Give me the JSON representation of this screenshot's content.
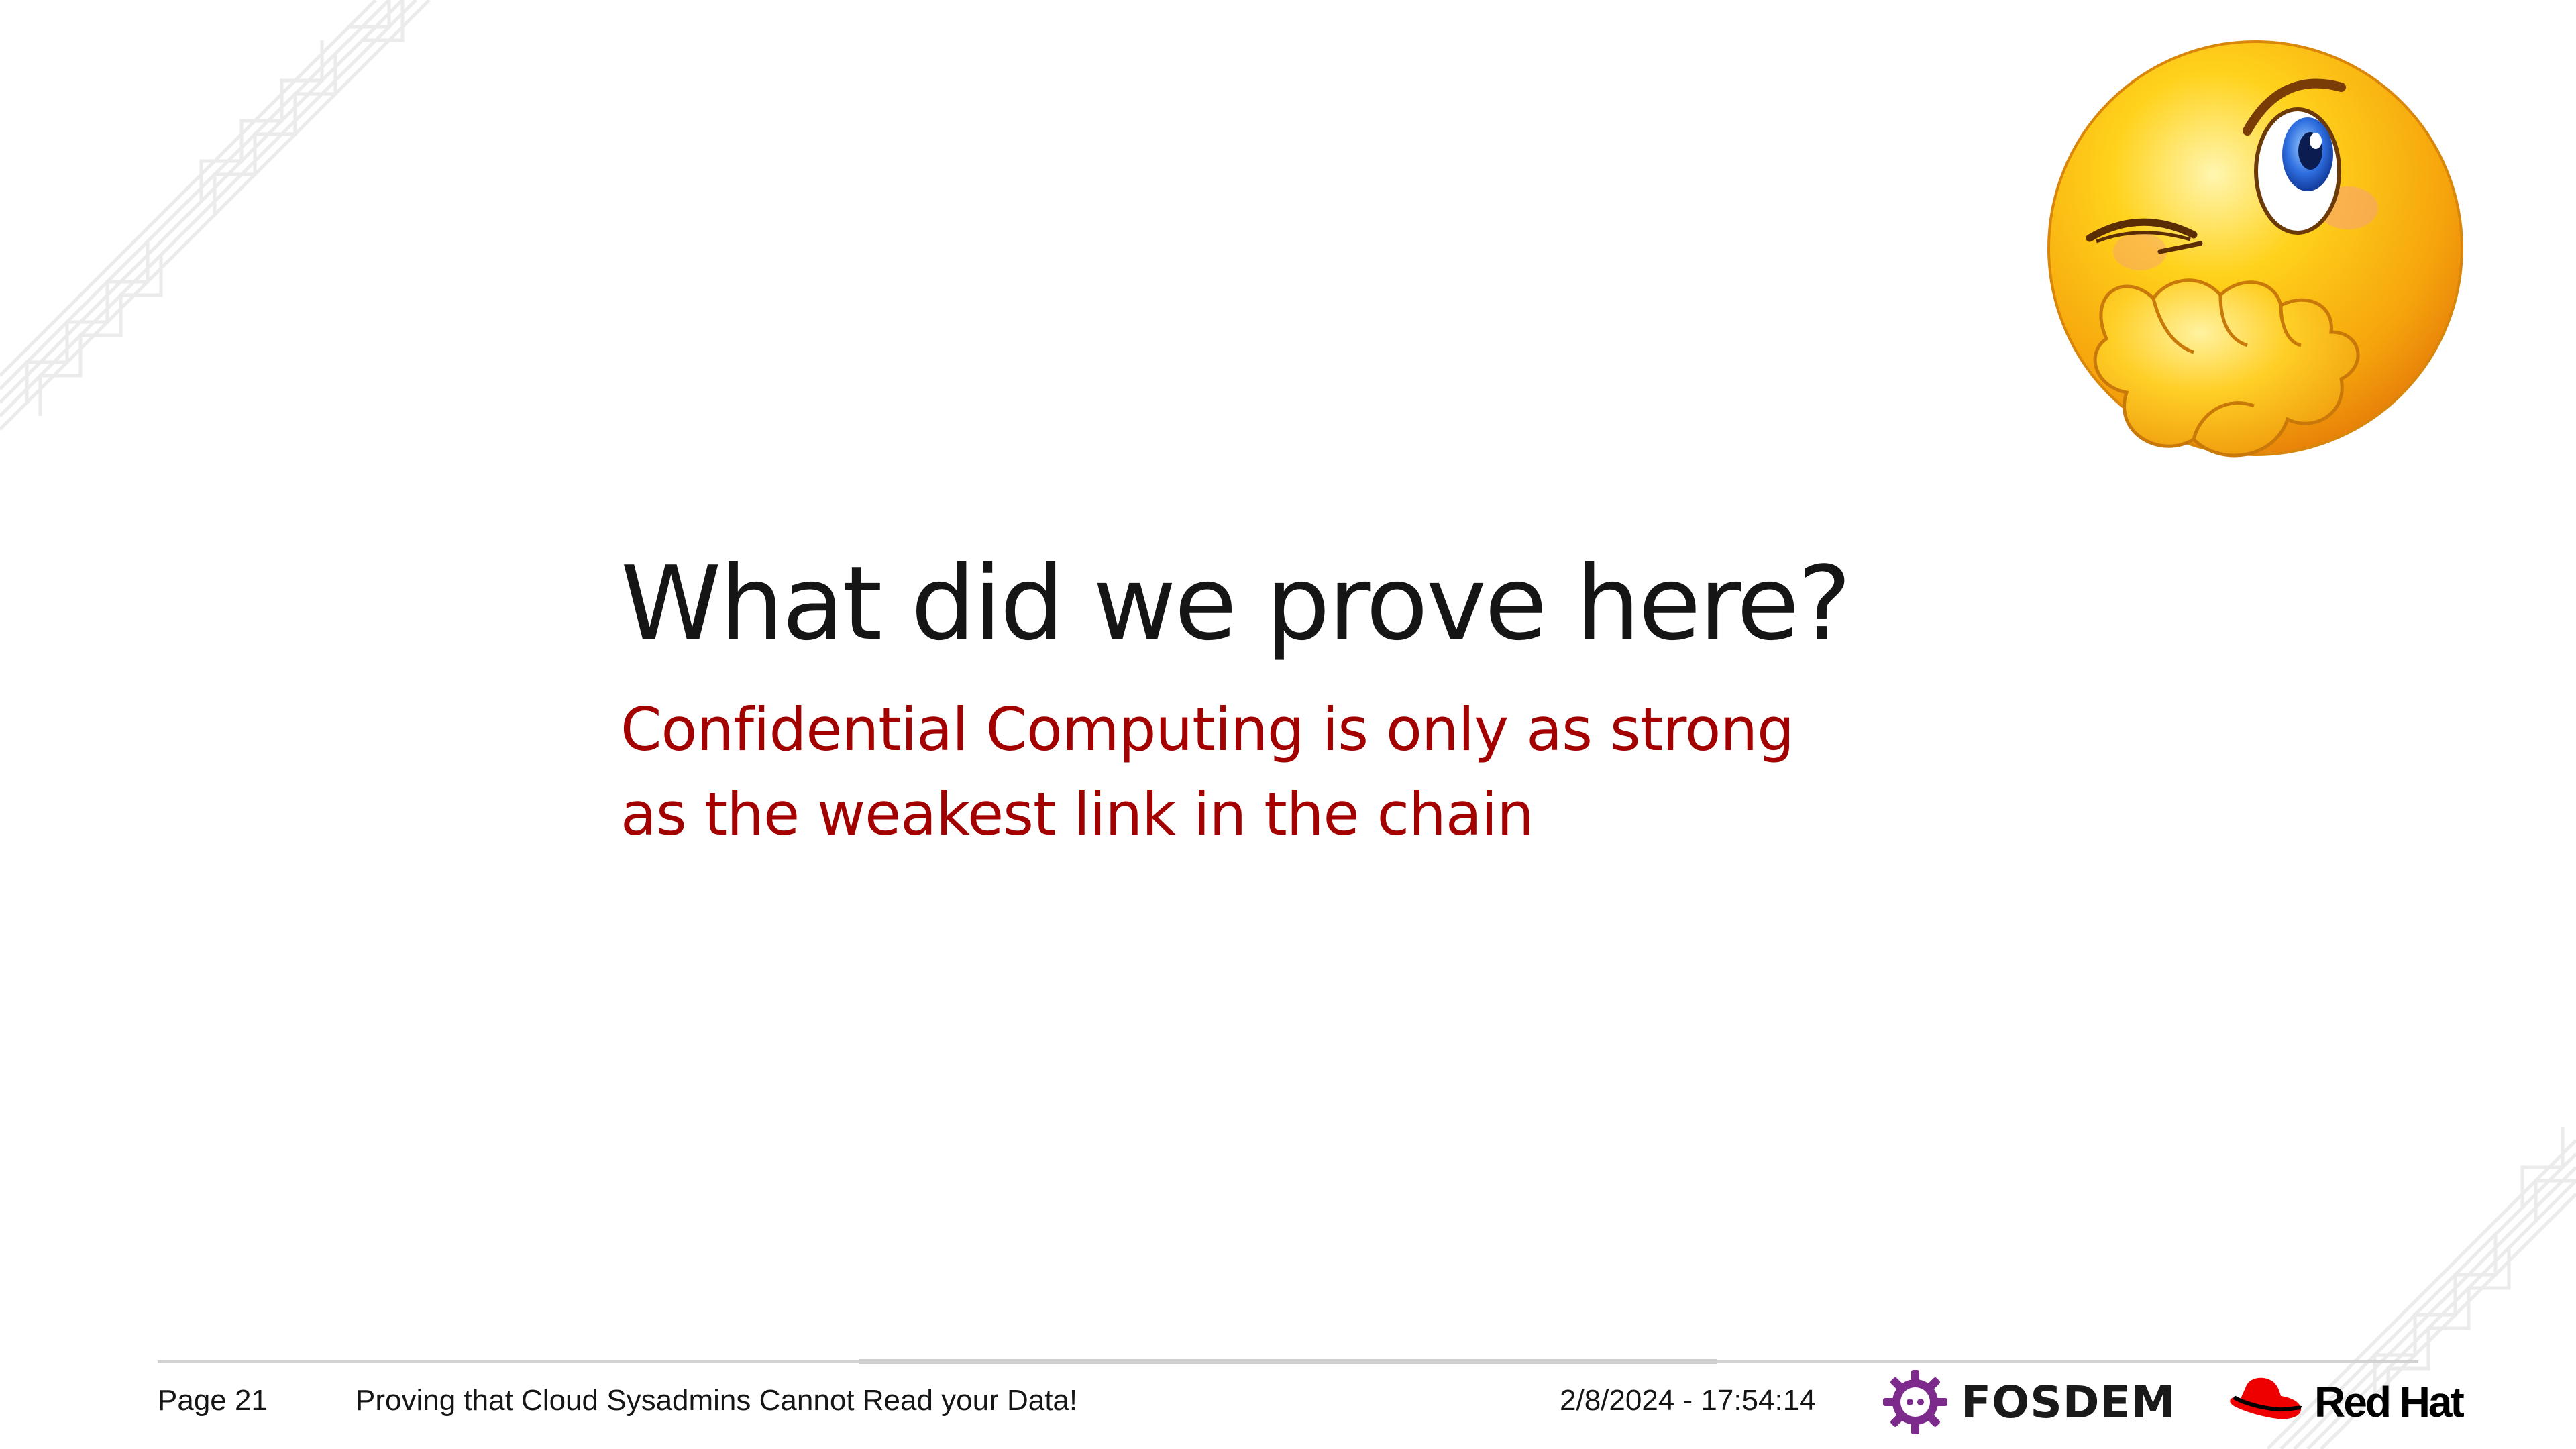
{
  "slide": {
    "title": "What did we prove here?",
    "subtitle_lines": [
      "Confidential Computing is only as strong",
      "as the weakest link in the chain"
    ],
    "illustration": "thinking-winking-emoji"
  },
  "footer": {
    "page_label": "Page 21",
    "deck_title": "Proving that Cloud Sysadmins Cannot Read your Data!",
    "timestamp": "2/8/2024 - 17:54:14",
    "fosdem_logo_text": "FOSDEM",
    "redhat_logo_text": "Red Hat"
  },
  "colors": {
    "title": "#151515",
    "subtitle": "#a30000",
    "fosdem_purple": "#7d2a8d",
    "redhat_red": "#ee0000",
    "decoration": "#e6e6e6"
  }
}
